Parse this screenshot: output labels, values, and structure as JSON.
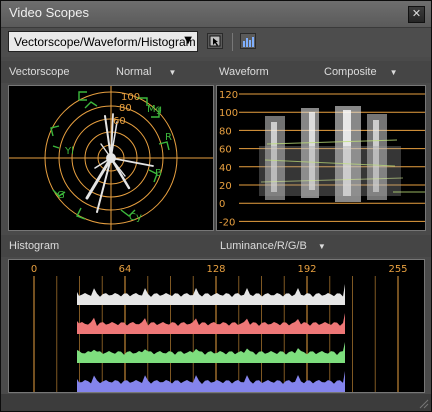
{
  "window": {
    "title": "Video Scopes",
    "close_glyph": "✕"
  },
  "toolbar": {
    "mode_select": "Vectorscope/Waveform/Histogram",
    "arrow": "▼",
    "icons": [
      "monitor-cursor-icon",
      "histogram-icon"
    ]
  },
  "vectorscope": {
    "label": "Vectorscope",
    "mode": "Normal",
    "mode_arrow": "▼",
    "rings": [
      "100",
      "80",
      "60"
    ],
    "targets": [
      "Mg",
      "R",
      "Yl",
      "G",
      "Cy",
      "B"
    ]
  },
  "waveform": {
    "label": "Waveform",
    "mode": "Composite",
    "mode_arrow": "▼",
    "scale": [
      "120",
      "100",
      "80",
      "60",
      "40",
      "20",
      "0",
      "-20"
    ]
  },
  "histogram": {
    "label": "Histogram",
    "mode": "Luminance/R/G/B",
    "mode_arrow": "▼",
    "scale": [
      "0",
      "64",
      "128",
      "192",
      "255"
    ],
    "channel_colors": [
      "#e6e6e6",
      "#ee7777",
      "#7ede7e",
      "#8484ec"
    ]
  },
  "colors": {
    "grid": "#e8a040",
    "trace": "#d8d8d8",
    "vector_green": "#3cb83c"
  }
}
